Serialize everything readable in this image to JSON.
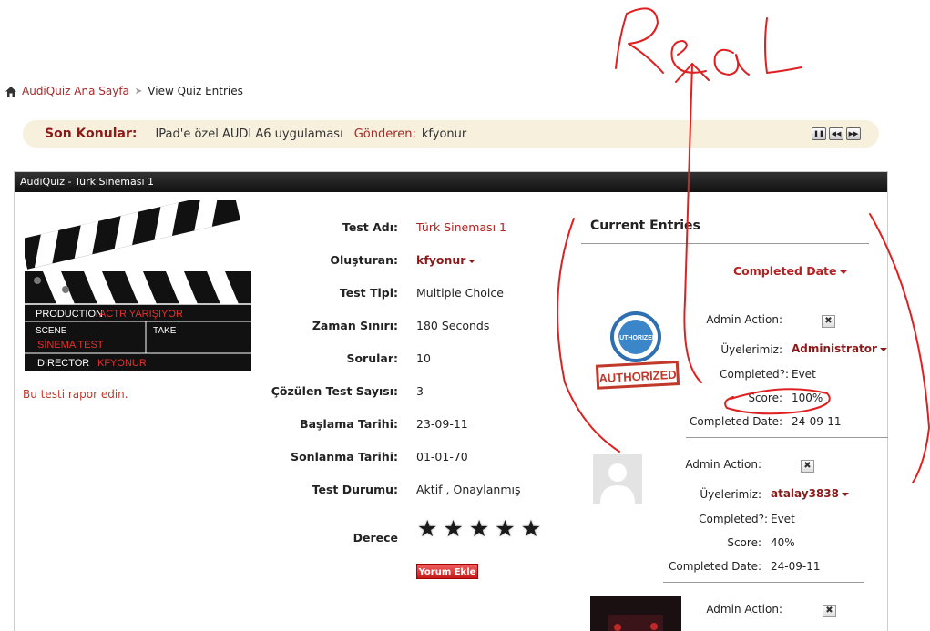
{
  "annotation": {
    "text": "Real"
  },
  "breadcrumb": {
    "home": "AudiQuiz Ana Sayfa",
    "current": "View Quiz Entries"
  },
  "news": {
    "label": "Son Konular:",
    "topic": "IPad'e özel AUDI A6 uygulaması",
    "by_label": "Gönderen:",
    "by_user": "kfyonur"
  },
  "panel": {
    "title": "AudiQuiz - Türk Sineması 1"
  },
  "clapper": {
    "production_label": "PRODUCTION",
    "production_value": "ACTR YARIŞIYOR",
    "scene_label": "SCENE",
    "scene_value": "SİNEMA TEST",
    "take_label": "TAKE",
    "director_label": "DIRECTOR",
    "director_value": "KFYONUR"
  },
  "report_link": "Bu testi rapor edin.",
  "quiz": {
    "rows": [
      {
        "label": "Test Adı:",
        "value": "Türk Sineması 1"
      },
      {
        "label": "Oluşturan:",
        "value": "kfyonur"
      },
      {
        "label": "Test Tipi:",
        "value": "Multiple Choice"
      },
      {
        "label": "Zaman Sınırı:",
        "value": "180 Seconds"
      },
      {
        "label": "Sorular:",
        "value": "10"
      },
      {
        "label": "Çözülen Test Sayısı:",
        "value": "3"
      },
      {
        "label": "Başlama Tarihi:",
        "value": "23-09-11"
      },
      {
        "label": "Sonlanma Tarihi:",
        "value": "01-01-70"
      },
      {
        "label": "Test Durumu:",
        "value": "Aktif , Onaylanmış"
      }
    ],
    "rating_label": "Derece",
    "rating_stars": 5,
    "comment_button": "Yorum Ekle"
  },
  "entries": {
    "title": "Current Entries",
    "sort_label": "Completed Date",
    "labels": {
      "admin": "Admin Action:",
      "member": "Üyelerimiz:",
      "completed": "Completed?:",
      "score": "Score:",
      "date": "Completed Date:"
    },
    "items": [
      {
        "avatar": "authorized-stamp",
        "avatar_text": "AUTHORIZED",
        "member": "Administrator",
        "completed": "Evet",
        "score": "100%",
        "date": "24-09-11"
      },
      {
        "avatar": "default-user",
        "member": "atalay3838",
        "completed": "Evet",
        "score": "40%",
        "date": "24-09-11"
      },
      {
        "avatar": "photo"
      }
    ]
  },
  "colors": {
    "link": "#a52a2a",
    "annotation": "#e02020",
    "header": "#1a1a1a"
  }
}
